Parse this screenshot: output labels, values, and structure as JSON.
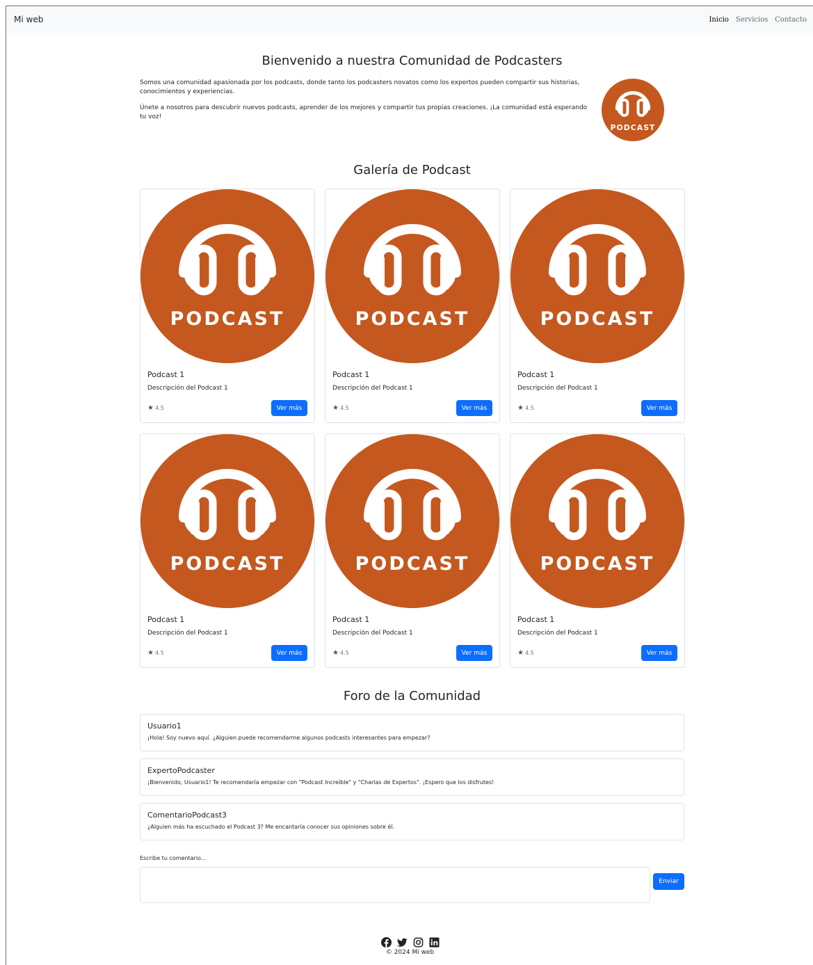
{
  "nav": {
    "brand": "Mi web",
    "links": [
      {
        "label": "Inicio",
        "active": true
      },
      {
        "label": "Servicios",
        "active": false
      },
      {
        "label": "Contacto",
        "active": false
      }
    ]
  },
  "hero": {
    "title": "Bienvenido a nuestra Comunidad de Podcasters",
    "paragraphs": [
      "Somos una comunidad apasionada por los podcasts, donde tanto los podcasters novatos como los expertos pueden compartir sus historias, conocimientos y experiencias.",
      "Únete a nosotros para descubrir nuevos podcasts, aprender de los mejores y compartir tus propias creaciones. ¡La comunidad está esperando tu voz!"
    ],
    "logo_text": "PODCAST"
  },
  "gallery": {
    "title": "Galería de Podcast",
    "image_text": "PODCAST",
    "cards": [
      {
        "title": "Podcast 1",
        "description": "Descripción del Podcast 1",
        "rating": "4.5",
        "button": "Ver más"
      },
      {
        "title": "Podcast 1",
        "description": "Descripción del Podcast 1",
        "rating": "4.5",
        "button": "Ver más"
      },
      {
        "title": "Podcast 1",
        "description": "Descripción del Podcast 1",
        "rating": "4.5",
        "button": "Ver más"
      },
      {
        "title": "Podcast 1",
        "description": "Descripción del Podcast 1",
        "rating": "4.5",
        "button": "Ver más"
      },
      {
        "title": "Podcast 1",
        "description": "Descripción del Podcast 1",
        "rating": "4.5",
        "button": "Ver más"
      },
      {
        "title": "Podcast 1",
        "description": "Descripción del Podcast 1",
        "rating": "4.5",
        "button": "Ver más"
      }
    ]
  },
  "forum": {
    "title": "Foro de la Comunidad",
    "posts": [
      {
        "user": "Usuario1",
        "text": "¡Hola! Soy nuevo aquí. ¿Alguien puede recomendarme algunos podcasts interesantes para empezar?"
      },
      {
        "user": "ExpertoPodcaster",
        "text": "¡Bienvenido, Usuario1! Te recomendaría empezar con \"Podcast Increíble\" y \"Charlas de Expertos\". ¡Espero que los disfrutes!"
      },
      {
        "user": "ComentarioPodcast3",
        "text": "¿Alguien más ha escuchado el Podcast 3? Me encantaría conocer sus opiniones sobre él."
      }
    ],
    "comment_label": "Escribe tu comentario...",
    "comment_value": "",
    "send_button": "Enviar"
  },
  "footer": {
    "social_icons": [
      "facebook-icon",
      "twitter-icon",
      "instagram-icon",
      "linkedin-icon"
    ],
    "copyright": "© 2024 Mi web"
  },
  "colors": {
    "podcast_orange": "#c4581f",
    "primary": "#0d6efd",
    "navbar_bg": "#f8f9fa"
  }
}
